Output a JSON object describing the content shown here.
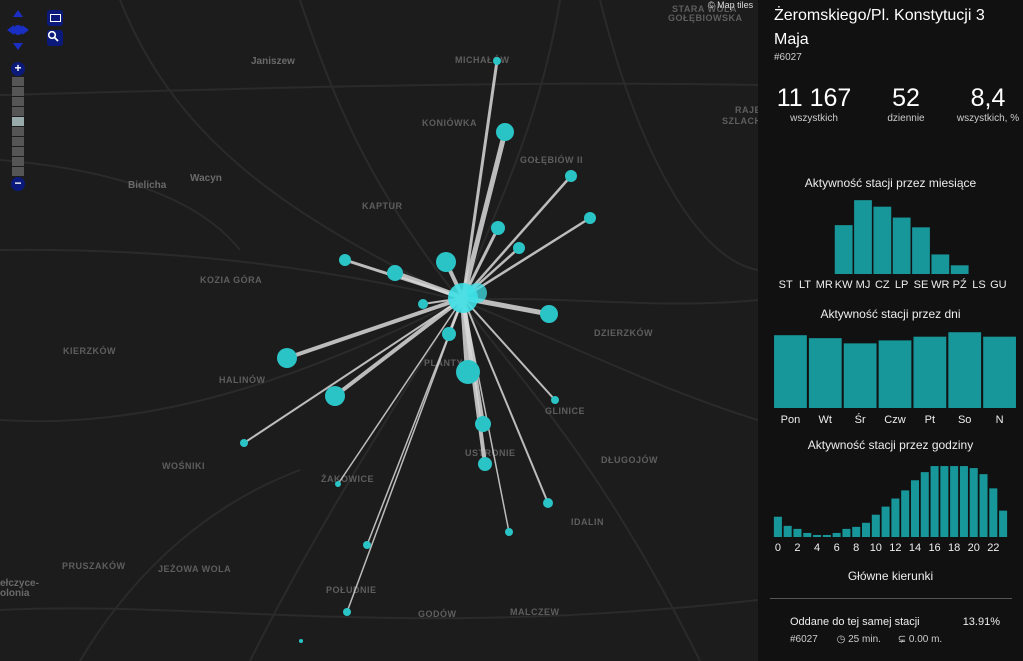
{
  "map": {
    "attribution": "© Map tiles",
    "labels": [
      {
        "text": "STARA WOLA",
        "cls": "lbl"
      },
      {
        "text": "GOŁĘBIOWSKA",
        "cls": "lbl"
      },
      {
        "text": "Janiszew",
        "cls": "lbl town"
      },
      {
        "text": "MICHAŁÓW",
        "cls": "lbl"
      },
      {
        "text": "RAJEC",
        "cls": "lbl"
      },
      {
        "text": "SZLACHECKI",
        "cls": "lbl"
      },
      {
        "text": "KONIÓWKA",
        "cls": "lbl"
      },
      {
        "text": "GOŁĘBIÓW II",
        "cls": "lbl"
      },
      {
        "text": "Bielicha",
        "cls": "lbl town"
      },
      {
        "text": "Wacyn",
        "cls": "lbl town"
      },
      {
        "text": "KAPTUR",
        "cls": "lbl"
      },
      {
        "text": "KOZIA GÓRA",
        "cls": "lbl"
      },
      {
        "text": "DZIERZKÓW",
        "cls": "lbl"
      },
      {
        "text": "KIERZKÓW",
        "cls": "lbl"
      },
      {
        "text": "HALINÓW",
        "cls": "lbl"
      },
      {
        "text": "PLANTY",
        "cls": "lbl"
      },
      {
        "text": "GLINICE",
        "cls": "lbl"
      },
      {
        "text": "WOŚNIKI",
        "cls": "lbl"
      },
      {
        "text": "USTRONIE",
        "cls": "lbl"
      },
      {
        "text": "DŁUGOJÓW",
        "cls": "lbl"
      },
      {
        "text": "ŻAKOWICE",
        "cls": "lbl"
      },
      {
        "text": "IDALIN",
        "cls": "lbl"
      },
      {
        "text": "PRUSZAKÓW",
        "cls": "lbl"
      },
      {
        "text": "JEŻOWA WOLA",
        "cls": "lbl"
      },
      {
        "text": "POŁUDNIE",
        "cls": "lbl"
      },
      {
        "text": "GODÓW",
        "cls": "lbl"
      },
      {
        "text": "MALCZEW",
        "cls": "lbl"
      },
      {
        "text": "ełczyce-",
        "cls": "lbl town"
      },
      {
        "text": "olonia",
        "cls": "lbl town"
      }
    ],
    "colors": {
      "station": "#2ac4c6",
      "line": "#d8d8d8",
      "center": "#3ee0e6"
    }
  },
  "controls": {
    "zoom_in": "+",
    "zoom_out": "−"
  },
  "station": {
    "name": "Żeromskiego/Pl. Konstytucji 3 Maja",
    "id": "#6027"
  },
  "stats": [
    {
      "value": "11 167",
      "caption": "wszystkich"
    },
    {
      "value": "52",
      "caption": "dziennie"
    },
    {
      "value": "8,4",
      "caption": "wszystkich, %"
    }
  ],
  "accent": "#17979a",
  "chart_data": [
    {
      "type": "bar",
      "title": "Aktywność stacji przez miesiące",
      "categories": [
        "ST",
        "LT",
        "MR",
        "KW",
        "MJ",
        "CZ",
        "LP",
        "SE",
        "WR",
        "PŹ",
        "LS",
        "GU"
      ],
      "values": [
        0,
        0,
        0,
        45,
        68,
        62,
        52,
        43,
        18,
        8,
        0,
        0
      ],
      "ylim": [
        0,
        70
      ]
    },
    {
      "type": "bar",
      "title": "Aktywność stacji przez dni",
      "categories": [
        "Pon",
        "Wt",
        "Śr",
        "Czw",
        "Pt",
        "So",
        "N"
      ],
      "values": [
        98,
        94,
        87,
        91,
        96,
        102,
        96
      ],
      "ylim": [
        0,
        105
      ]
    },
    {
      "type": "bar",
      "title": "Aktywność stacji przez godziny",
      "categories": [
        "0",
        "1",
        "2",
        "3",
        "4",
        "5",
        "6",
        "7",
        "8",
        "9",
        "10",
        "11",
        "12",
        "13",
        "14",
        "15",
        "16",
        "17",
        "18",
        "19",
        "20",
        "21",
        "22",
        "23"
      ],
      "tick_labels": [
        "0",
        "2",
        "4",
        "6",
        "8",
        "10",
        "12",
        "14",
        "16",
        "18",
        "20",
        "22"
      ],
      "values": [
        20,
        11,
        8,
        4,
        2,
        2,
        4,
        8,
        10,
        14,
        22,
        30,
        38,
        46,
        56,
        64,
        70,
        70,
        70,
        70,
        68,
        62,
        48,
        26
      ],
      "ylim": [
        0,
        75
      ]
    }
  ],
  "directions": {
    "title": "Główne kierunki",
    "items": [
      {
        "name": "Oddane do tej samej stacji",
        "percent": "13.91%",
        "id": "#6027",
        "time": "25 min.",
        "distance": "0.00 m."
      }
    ]
  }
}
